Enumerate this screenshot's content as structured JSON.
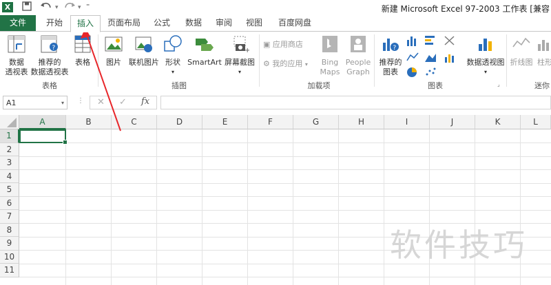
{
  "title_bar": {
    "app_icon": "X",
    "icons": [
      "save-icon",
      "undo-icon",
      "redo-icon",
      "customize-icon"
    ],
    "title": "新建 Microsoft Excel 97-2003 工作表 [兼容"
  },
  "tabs": [
    {
      "label": "文件"
    },
    {
      "label": "开始"
    },
    {
      "label": "插入"
    },
    {
      "label": "页面布局"
    },
    {
      "label": "公式"
    },
    {
      "label": "数据"
    },
    {
      "label": "审阅"
    },
    {
      "label": "视图"
    },
    {
      "label": "百度网盘"
    }
  ],
  "ribbon": {
    "groups": {
      "tables": "表格",
      "illustrations": "插图",
      "addins": "加载项",
      "charts": "图表",
      "sparklines": "迷你"
    },
    "buttons": {
      "pivot_table_1": "数据",
      "pivot_table_2": "透视表",
      "rec_pivot_1": "推荐的",
      "rec_pivot_2": "数据透视表",
      "table": "表格",
      "picture": "图片",
      "online_picture": "联机图片",
      "shapes": "形状",
      "smartart": "SmartArt",
      "screenshot": "屏幕截图",
      "app_store": "应用商店",
      "my_apps": "我的应用",
      "bing_1": "Bing",
      "bing_2": "Maps",
      "people_1": "People",
      "people_2": "Graph",
      "rec_charts_1": "推荐的",
      "rec_charts_2": "图表",
      "pivot_chart": "数据透视图",
      "line": "折线图",
      "column": "柱形"
    }
  },
  "formula_bar": {
    "name_box": "A1",
    "fx": "fx",
    "formula": ""
  },
  "grid": {
    "columns": [
      "A",
      "B",
      "C",
      "D",
      "E",
      "F",
      "G",
      "H",
      "I",
      "J",
      "K",
      "L"
    ],
    "rows": [
      "1",
      "2",
      "3",
      "4",
      "5",
      "6",
      "7",
      "8",
      "9",
      "10",
      "11"
    ],
    "selected_cell": "A1"
  },
  "watermark": "软件技巧",
  "colors": {
    "accent": "#217346",
    "annotation": "#e8262a"
  }
}
